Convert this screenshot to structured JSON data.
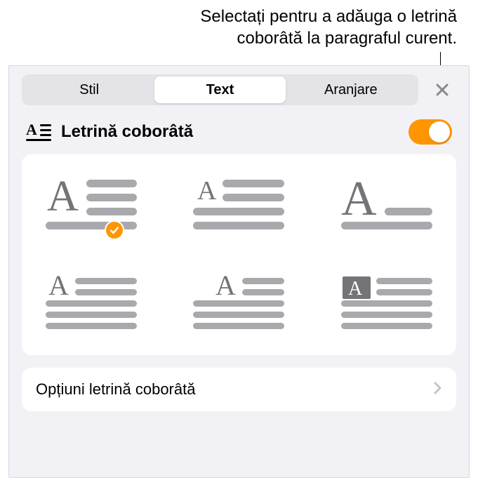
{
  "callout": {
    "line1": "Selectați pentru a adăuga o letrină",
    "line2": "coborâtă la paragraful curent."
  },
  "tabs": {
    "style": "Stil",
    "text": "Text",
    "arrange": "Aranjare"
  },
  "section": {
    "title": "Letrină coborâtă"
  },
  "options_row": {
    "label": "Opțiuni letrină coborâtă"
  },
  "colors": {
    "accent": "#ff9500"
  },
  "toggle": {
    "on": true
  },
  "style_names": [
    "dropcap-large-inline",
    "dropcap-small-inline",
    "dropcap-raised",
    "dropcap-on-top",
    "dropcap-indented",
    "dropcap-boxed"
  ],
  "selected_style_index": 0
}
